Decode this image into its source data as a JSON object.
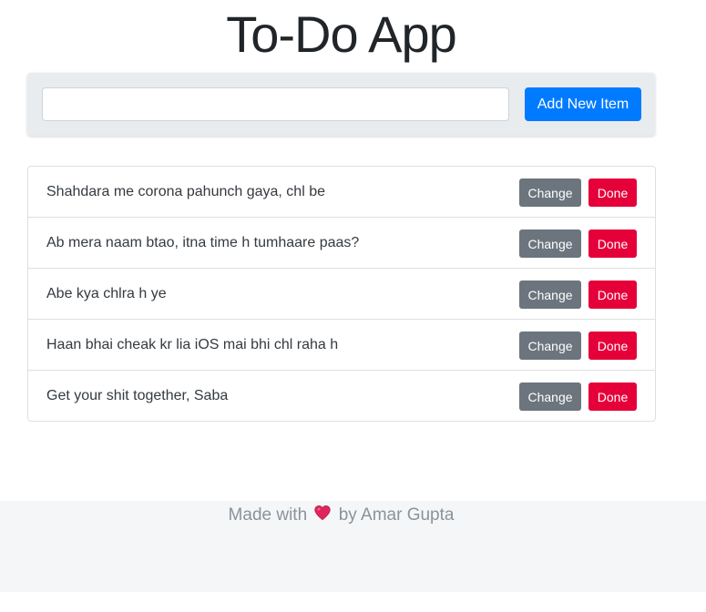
{
  "app": {
    "title": "To-Do App"
  },
  "form": {
    "input_value": "",
    "input_placeholder": "",
    "add_button_label": "Add New Item"
  },
  "todos": [
    {
      "text": "Shahdara me corona pahunch gaya, chl be",
      "change_label": "Change",
      "done_label": "Done"
    },
    {
      "text": "Ab mera naam btao, itna time h tumhaare paas?",
      "change_label": "Change",
      "done_label": "Done"
    },
    {
      "text": "Abe kya chlra h ye",
      "change_label": "Change",
      "done_label": "Done"
    },
    {
      "text": "Haan bhai cheak kr lia iOS mai bhi chl raha h",
      "change_label": "Change",
      "done_label": "Done"
    },
    {
      "text": "Get your shit together, Saba",
      "change_label": "Change",
      "done_label": "Done"
    }
  ],
  "footer": {
    "prefix": "Made with",
    "icon": "heart-icon",
    "suffix": "by Amar Gupta"
  },
  "colors": {
    "primary": "#007bff",
    "secondary": "#6c757d",
    "danger": "#e6003a",
    "heart": "#e0245e"
  }
}
